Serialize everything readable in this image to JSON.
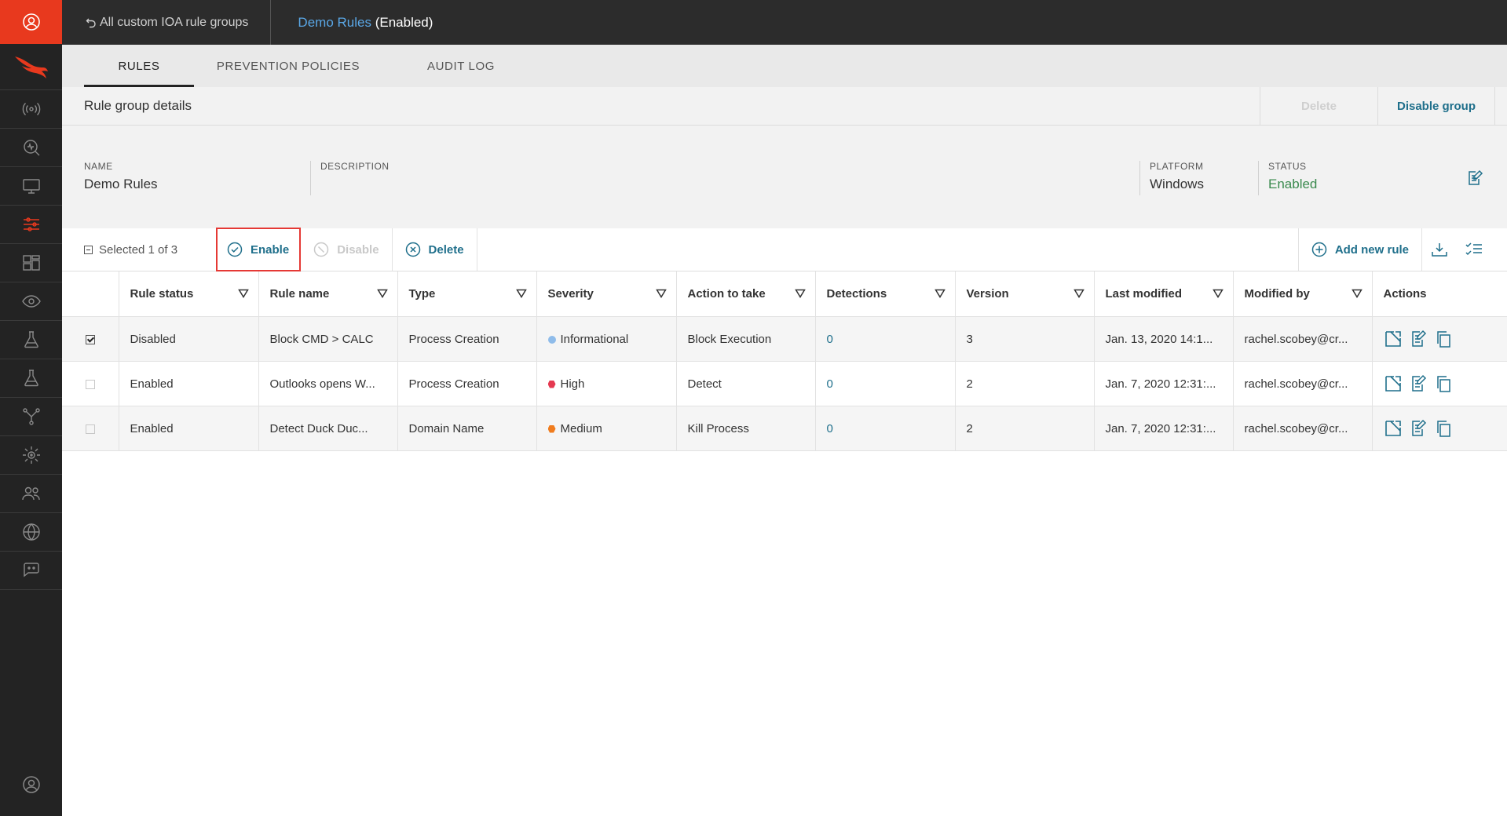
{
  "colors": {
    "accent": "#1f6f8b",
    "enabled_green": "#3a8a4e",
    "brand_red": "#e8391e",
    "sev_informational": "#8fbcea",
    "sev_high": "#e53950",
    "sev_medium": "#f07c1e"
  },
  "sidebar": {
    "items": [
      {
        "icon": "broadcast-icon"
      },
      {
        "icon": "search-activity-icon"
      },
      {
        "icon": "monitor-icon"
      },
      {
        "icon": "sliders-icon",
        "active": true
      },
      {
        "icon": "dashboard-icon"
      },
      {
        "icon": "eye-icon"
      },
      {
        "icon": "flask-icon"
      },
      {
        "icon": "flask-icon"
      },
      {
        "icon": "network-icon"
      },
      {
        "icon": "sun-target-icon"
      },
      {
        "icon": "users-icon"
      },
      {
        "icon": "globe-gear-icon"
      },
      {
        "icon": "chat-icon"
      }
    ]
  },
  "topbar": {
    "back_label": "All custom IOA rule groups",
    "group_name": "Demo Rules",
    "group_state": "(Enabled)"
  },
  "tabs": [
    {
      "label": "RULES",
      "active": true
    },
    {
      "label": "PREVENTION POLICIES",
      "active": false
    },
    {
      "label": "AUDIT LOG",
      "active": false
    }
  ],
  "details": {
    "title": "Rule group details",
    "delete_label": "Delete",
    "disable_label": "Disable group",
    "name_label": "NAME",
    "name_value": "Demo Rules",
    "description_label": "DESCRIPTION",
    "description_value": "",
    "platform_label": "PLATFORM",
    "platform_value": "Windows",
    "status_label": "STATUS",
    "status_value": "Enabled"
  },
  "toolbar": {
    "selected_text": "Selected 1 of 3",
    "enable_label": "Enable",
    "disable_label": "Disable",
    "delete_label": "Delete",
    "add_rule_label": "Add new rule"
  },
  "table": {
    "columns": [
      "Rule status",
      "Rule name",
      "Type",
      "Severity",
      "Action to take",
      "Detections",
      "Version",
      "Last modified",
      "Modified by",
      "Actions"
    ],
    "rows": [
      {
        "checked": true,
        "status": "Disabled",
        "name": "Block CMD > CALC",
        "type": "Process Creation",
        "severity": "Informational",
        "action": "Block Execution",
        "detections": "0",
        "version": "3",
        "modified": "Jan. 13, 2020 14:1...",
        "modified_by": "rachel.scobey@cr..."
      },
      {
        "checked": false,
        "status": "Enabled",
        "name": "Outlooks opens W...",
        "type": "Process Creation",
        "severity": "High",
        "action": "Detect",
        "detections": "0",
        "version": "2",
        "modified": "Jan. 7, 2020 12:31:...",
        "modified_by": "rachel.scobey@cr..."
      },
      {
        "checked": false,
        "status": "Enabled",
        "name": "Detect Duck Duc...",
        "type": "Domain Name",
        "severity": "Medium",
        "action": "Kill Process",
        "detections": "0",
        "version": "2",
        "modified": "Jan. 7, 2020 12:31:...",
        "modified_by": "rachel.scobey@cr..."
      }
    ]
  }
}
